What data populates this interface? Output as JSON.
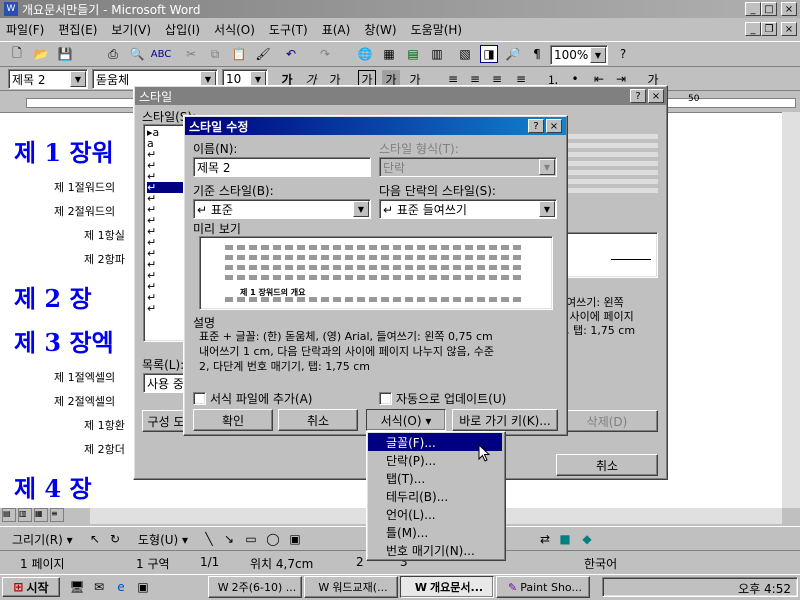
{
  "app": {
    "title": "개요문서만들기 - Microsoft Word"
  },
  "menubar": [
    "파일(F)",
    "편집(E)",
    "보기(V)",
    "삽입(I)",
    "서식(O)",
    "도구(T)",
    "표(A)",
    "창(W)",
    "도움말(H)"
  ],
  "toolbar": {
    "zoom": "100%"
  },
  "format_bar": {
    "style": "제목 2",
    "font": "돋움체",
    "size": "10"
  },
  "document": {
    "h1": [
      "제 1 장워",
      "제 2 장",
      "제 3 장엑",
      "제 4 장"
    ],
    "items": [
      "제 1절워드의",
      "제 2절워드의",
      "제 1항실",
      "제 2항파",
      "제 1절엑셀의",
      "제 2절엑셀의",
      "제 1항환",
      "제 2항더"
    ]
  },
  "style_dialog": {
    "title": "스타일",
    "styles_label": "스타일(S):",
    "list_label": "목록(L):",
    "list_value": "사용 중",
    "org_button": "구성 도",
    "delete_button": "삭제(D)",
    "cancel_button": "취소",
    "desc_fragment": "여쓰기: 왼쪽\n 사이에 페이지\n, 탭: 1,75 cm",
    "ruler_50": "50"
  },
  "modify_dialog": {
    "title": "스타일 수정",
    "name_label": "이름(N):",
    "name_value": "제목 2",
    "type_label": "스타일 형식(T):",
    "type_value": "단락",
    "based_label": "기준 스타일(B):",
    "based_value": "↵ 표준",
    "next_label": "다음 단락의 스타일(S):",
    "next_value": "↵ 표준 들여쓰기",
    "preview_label": "미리 보기",
    "preview_sample": "제 1 장워드의 개요",
    "desc_label": "설명",
    "desc_text": "표준 + 글꼴: (한) 돋움체, (영) Arial, 들여쓰기: 왼쪽 0,75 cm\n내어쓰기 1 cm, 다음 단락과의 사이에 페이지 나누지 않음, 수준\n2, 다단계 번호 매기기, 탭: 1,75 cm",
    "add_template": "서식 파일에 추가(A)",
    "auto_update": "자동으로 업데이트(U)",
    "ok": "확인",
    "cancel": "취소",
    "format": "서식(O) ▾",
    "shortcut": "바로 가기 키(K)..."
  },
  "format_menu": [
    "글꼴(F)...",
    "단락(P)...",
    "탭(T)...",
    "테두리(B)...",
    "언어(L)...",
    "틀(M)...",
    "번호 매기기(N)..."
  ],
  "drawing_bar": {
    "draw": "그리기(R) ▾",
    "shapes": "도형(U) ▾"
  },
  "statusbar": {
    "page": "1 페이지",
    "section": "1 구역",
    "pages": "1/1",
    "pos": "위치 4,7cm",
    "line": "2",
    "col": "3",
    "lang": "한국어"
  },
  "taskbar": {
    "start": "시작",
    "tasks": [
      "2주(6-10) ...",
      "워드교재(...",
      "개요문서...",
      "Paint Sho..."
    ],
    "clock": "오후 4:52"
  }
}
